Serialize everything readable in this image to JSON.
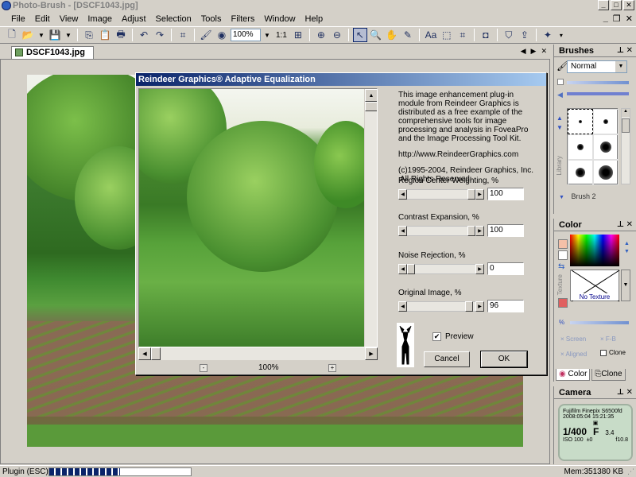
{
  "window": {
    "title": "Photo-Brush - [DSCF1043.jpg]"
  },
  "menu": [
    "File",
    "Edit",
    "View",
    "Image",
    "Adjust",
    "Selection",
    "Tools",
    "Filters",
    "Window",
    "Help"
  ],
  "toolbar": {
    "zoom_value": "100%",
    "ratio_label": "1:1"
  },
  "document": {
    "tab_label": "DSCF1043.jpg"
  },
  "dialog": {
    "title": "Reindeer Graphics® Adaptive Equalization",
    "info_paragraph": "This image enhancement plug-in module from Reindeer Graphics is distributed as a free example of the comprehensive tools for image processing and analysis in FoveaPro and the Image Processing Tool Kit.",
    "url": "http://www.ReindeerGraphics.com",
    "copyright_line1": "(c)1995-2004, Reindeer Graphics, Inc.",
    "copyright_line2": "All Rights Reserved.",
    "preview_zoom": "100%",
    "preview_checkbox_label": "Preview",
    "preview_checked": true,
    "cancel_label": "Cancel",
    "ok_label": "OK",
    "sliders": [
      {
        "label": "Region Center Weighting, %",
        "value": "100",
        "level": 1.0
      },
      {
        "label": "Contrast Expansion, %",
        "value": "100",
        "level": 1.0
      },
      {
        "label": "Noise Rejection, %",
        "value": "0",
        "level": 0.0
      },
      {
        "label": "Original Image, %",
        "value": "96",
        "level": 0.96
      }
    ]
  },
  "brushes_panel": {
    "title": "Brushes",
    "blend_mode": "Normal",
    "library_label": "Library",
    "selected_brush_name": "Brush 2"
  },
  "color_panel": {
    "title": "Color",
    "texture_label": "Texture",
    "no_texture_label": "No Texture",
    "screen_label": "Screen",
    "fb_label": "F-B",
    "aligned_label": "Aligned",
    "clone_check_label": "Clone",
    "tab_color": "Color",
    "tab_clone": "Clone"
  },
  "camera_panel": {
    "title": "Camera",
    "model": "Fujifilm Finepix S6500fd",
    "datetime": "2008:05:04 15:21:35",
    "shutter": "1/400",
    "aperture_label": "F",
    "aperture_value": "3.4",
    "iso": "ISO 100",
    "ev": "±0",
    "focal": "f10.8"
  },
  "status": {
    "left_text": "Plugin (ESC)",
    "progress": 0.5,
    "memory": "Mem:351380 KB"
  }
}
